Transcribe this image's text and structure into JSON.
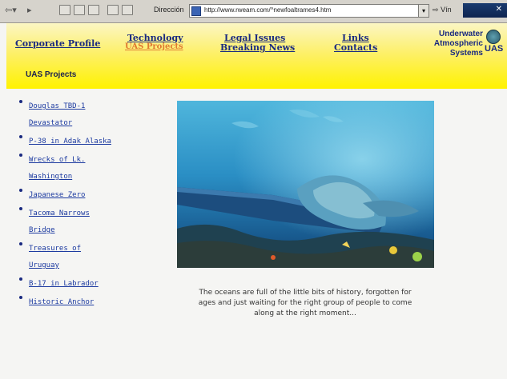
{
  "browser": {
    "address_label": "Dirección",
    "url": "http://www.rweam.com/^newfoaltrames4.htm",
    "go_label": "Vín"
  },
  "nav": {
    "corporate_profile": "Corporate Profile",
    "technology": "Technology",
    "uas_projects": "UAS Projects",
    "legal_issues": "Legal Issues",
    "breaking_news": "Breaking News",
    "links": "Links",
    "contacts": "Contacts"
  },
  "logo": {
    "line1": "Underwater",
    "line2": "Atmospheric",
    "line3": "Systems",
    "mark": "UAS"
  },
  "section_title": "UAS Projects",
  "sidebar": {
    "items": [
      {
        "label": "Douglas TBD-1 Devastator"
      },
      {
        "label": "P-38 in Adak Alaska"
      },
      {
        "label": "Wrecks of Lk. Washington"
      },
      {
        "label": "Japanese Zero"
      },
      {
        "label": "Tacoma Narrows Bridge"
      },
      {
        "label": "Treasures of Uruguay"
      },
      {
        "label": "B-17 in Labrador"
      },
      {
        "label": "Historic Anchor"
      }
    ]
  },
  "caption": "The oceans are full of the little bits of history, forgotten for ages and just waiting for the right group of people to come along at the right moment..."
}
